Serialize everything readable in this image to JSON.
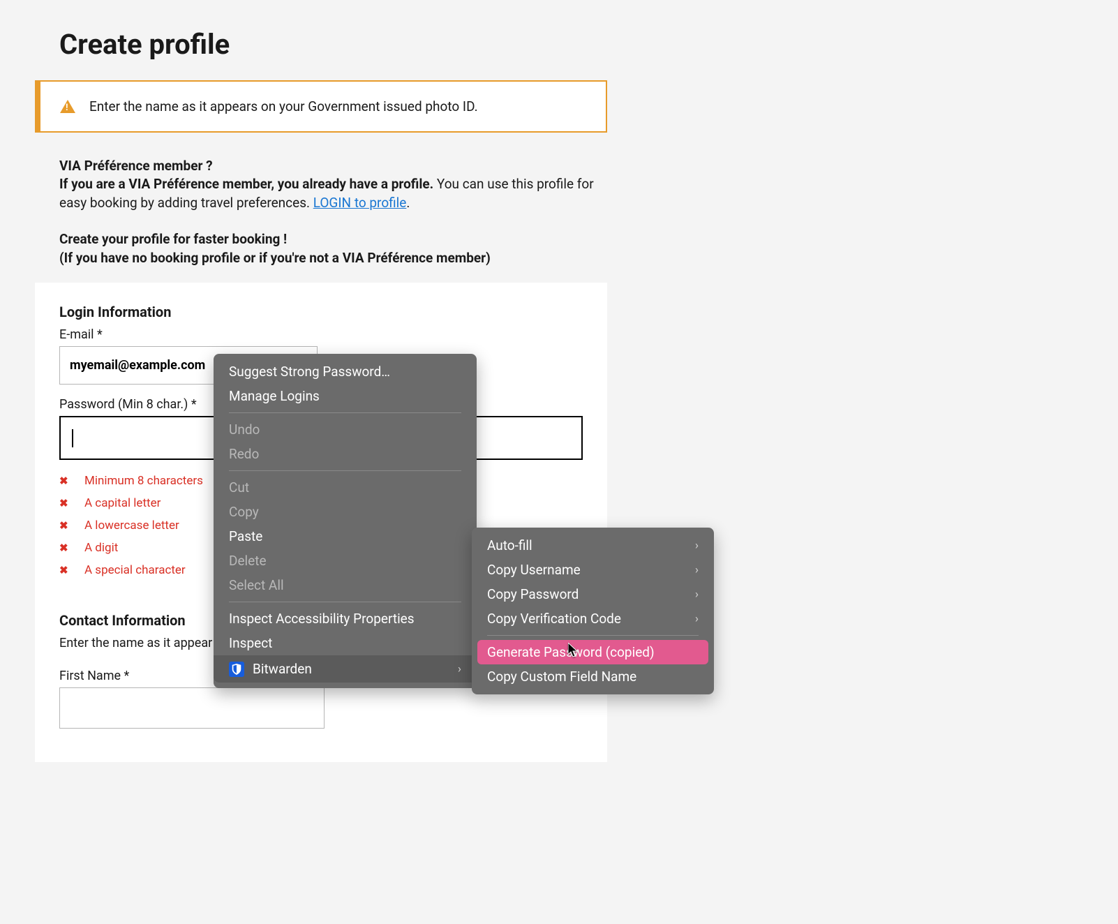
{
  "page": {
    "title": "Create profile"
  },
  "alert": {
    "text": "Enter the name as it appears on your Government issued photo ID."
  },
  "intro": {
    "member_question": "VIA Préférence member ?",
    "member_line_bold": "If you are a VIA Préférence member, you already have a profile.",
    "member_line_rest": " You can use this profile for easy booking by adding travel preferences. ",
    "login_link": "LOGIN to profile",
    "period": ".",
    "create_line1": "Create your profile for faster booking !",
    "create_line2": "(If you have no booking profile or if you're not a VIA Préférence member)"
  },
  "form": {
    "login_heading": "Login Information",
    "email_label": "E-mail *",
    "email_value": "myemail@example.com",
    "password_label": "Password (Min 8 char.) *",
    "password_value": "",
    "rules": [
      "Minimum 8 characters",
      "A capital letter",
      "A lowercase letter",
      "A digit",
      "A special character"
    ],
    "contact_heading": "Contact Information",
    "contact_desc": "Enter the name as it appear",
    "first_name_label": "First Name *"
  },
  "context_menu": {
    "suggest_password": "Suggest Strong Password…",
    "manage_logins": "Manage Logins",
    "undo": "Undo",
    "redo": "Redo",
    "cut": "Cut",
    "copy": "Copy",
    "paste": "Paste",
    "delete": "Delete",
    "select_all": "Select All",
    "inspect_a11y": "Inspect Accessibility Properties",
    "inspect": "Inspect",
    "bitwarden": "Bitwarden"
  },
  "submenu": {
    "autofill": "Auto-fill",
    "copy_username": "Copy Username",
    "copy_password": "Copy Password",
    "copy_verification": "Copy Verification Code",
    "generate_password": "Generate Password (copied)",
    "copy_custom_field": "Copy Custom Field Name"
  }
}
